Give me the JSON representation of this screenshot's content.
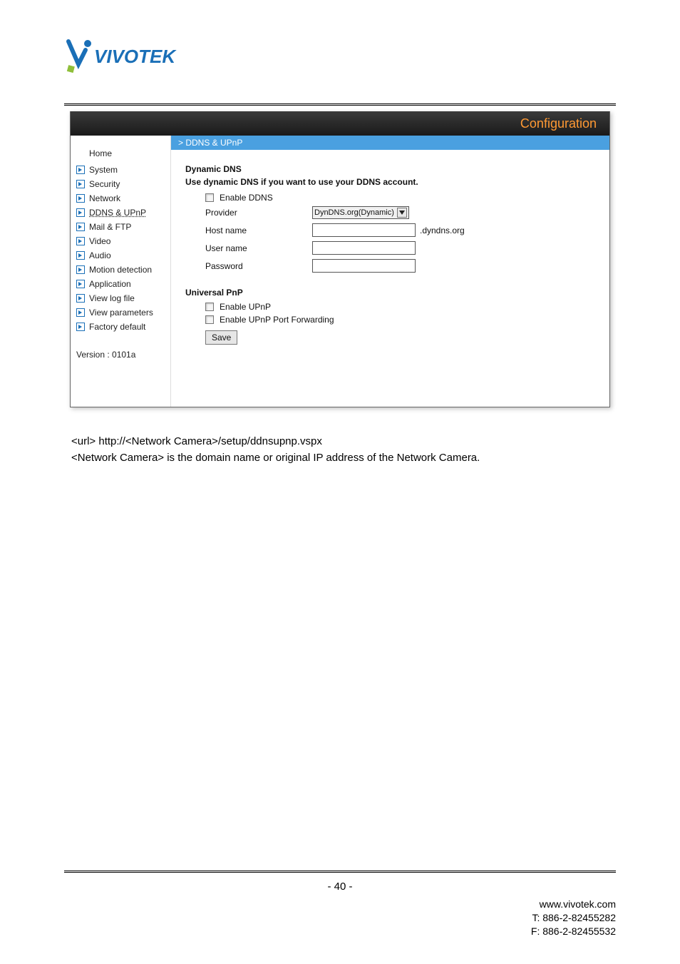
{
  "logo_text": "VIVOTEK",
  "config_banner": "Configuration",
  "breadcrumb": "> DDNS & UPnP",
  "sidebar": {
    "home": "Home",
    "items": [
      {
        "label": "System"
      },
      {
        "label": "Security"
      },
      {
        "label": "Network"
      },
      {
        "label": "DDNS & UPnP",
        "active": true
      },
      {
        "label": "Mail & FTP"
      },
      {
        "label": "Video"
      },
      {
        "label": "Audio"
      },
      {
        "label": "Motion detection"
      },
      {
        "label": "Application"
      },
      {
        "label": "View log file"
      },
      {
        "label": "View parameters"
      },
      {
        "label": "Factory default"
      }
    ],
    "version": "Version : 0101a"
  },
  "ddns": {
    "title": "Dynamic DNS",
    "subtitle": "Use dynamic DNS if you want to use your DDNS account.",
    "enable_label": "Enable DDNS",
    "provider_label": "Provider",
    "provider_value": "DynDNS.org(Dynamic)",
    "hostname_label": "Host name",
    "hostname_suffix": ".dyndns.org",
    "username_label": "User name",
    "password_label": "Password"
  },
  "upnp": {
    "title": "Universal PnP",
    "enable_label": "Enable UPnP",
    "port_label": "Enable UPnP Port Forwarding"
  },
  "save_label": "Save",
  "below": {
    "line1": "<url> http://<Network Camera>/setup/ddnsupnp.vspx",
    "line2": "<Network Camera> is the domain name or original IP address of the Network Camera."
  },
  "page_number": "- 40 -",
  "footer": {
    "site": "www.vivotek.com",
    "tel": "T: 886-2-82455282",
    "fax": "F: 886-2-82455532"
  }
}
